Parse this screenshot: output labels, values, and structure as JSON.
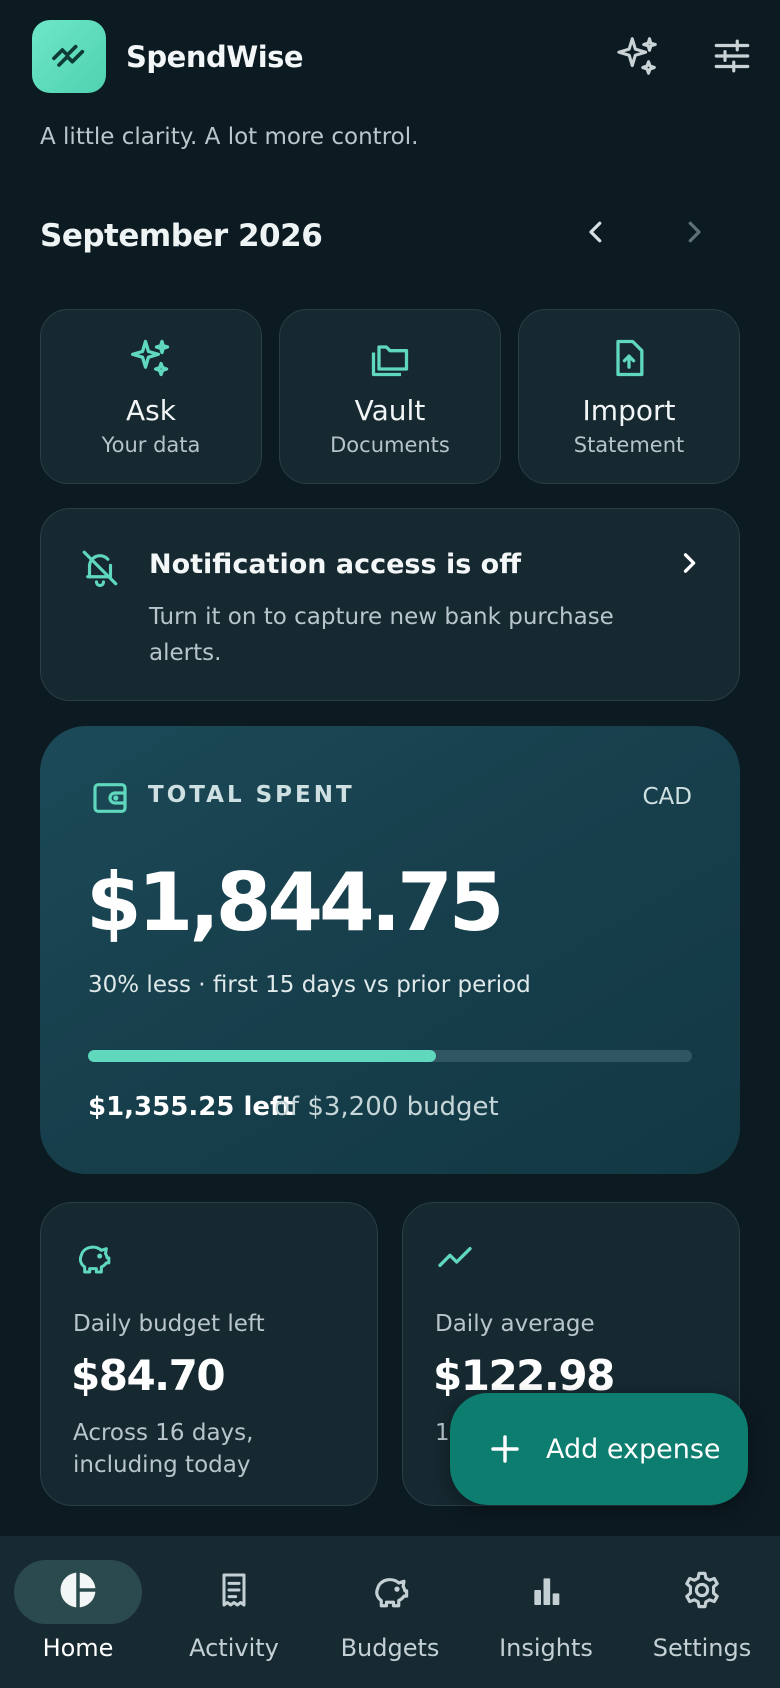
{
  "colors": {
    "background": "#0c1a22",
    "card": "#162830",
    "accent": "#5fd8bd",
    "fab": "#0d7d70",
    "hero_card": "#173f4c"
  },
  "header": {
    "app_name": "SpendWise",
    "tagline": "A little clarity. A lot more control.",
    "logo_icon": "trend-up-icon",
    "actions": [
      {
        "icon": "sparkles-icon"
      },
      {
        "icon": "sliders-icon"
      }
    ]
  },
  "month": {
    "label": "September 2026",
    "prev_icon": "chevron-left-icon",
    "next_icon": "chevron-right-icon"
  },
  "quick_actions": [
    {
      "icon": "sparkles-icon",
      "title": "Ask",
      "subtitle": "Your data"
    },
    {
      "icon": "folder-icon",
      "title": "Vault",
      "subtitle": "Documents"
    },
    {
      "icon": "file-upload-icon",
      "title": "Import",
      "subtitle": "Statement"
    }
  ],
  "notification": {
    "icon": "bell-off-icon",
    "title": "Notification access is off",
    "body": "Turn it on to capture new bank purchase alerts."
  },
  "total": {
    "icon": "wallet-icon",
    "label": "TOTAL SPENT",
    "currency": "CAD",
    "amount": "$1,844.75",
    "comparison": "30% less · first 15 days vs prior period",
    "progress_fraction": 0.576,
    "left": "$1,355.25 left",
    "of_budget": "of $3,200 budget"
  },
  "stats": [
    {
      "icon": "piggy-bank-icon",
      "label": "Daily budget left",
      "value": "$84.70",
      "note": "Across 16 days, including today"
    },
    {
      "icon": "trend-up-icon",
      "label": "Daily average",
      "value": "$122.98",
      "note": "1"
    }
  ],
  "fab": {
    "icon": "plus-icon",
    "label": "Add expense"
  },
  "bottom_nav": [
    {
      "icon": "pie-chart-icon",
      "label": "Home",
      "active": true
    },
    {
      "icon": "receipt-icon",
      "label": "Activity",
      "active": false
    },
    {
      "icon": "piggy-bank-icon",
      "label": "Budgets",
      "active": false
    },
    {
      "icon": "bar-chart-icon",
      "label": "Insights",
      "active": false
    },
    {
      "icon": "gear-icon",
      "label": "Settings",
      "active": false
    }
  ]
}
